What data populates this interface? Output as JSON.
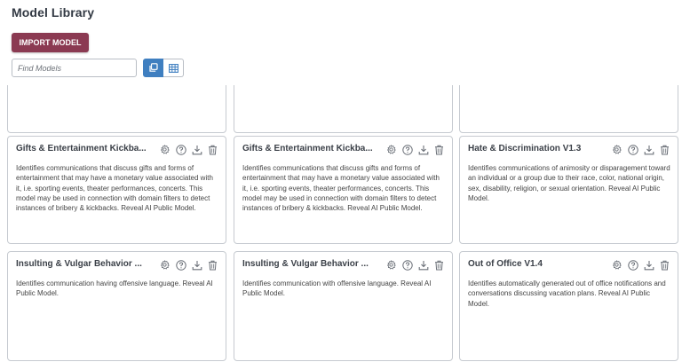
{
  "header": {
    "title": "Model Library"
  },
  "toolbar": {
    "import_label": "IMPORT MODEL",
    "search_placeholder": "Find Models",
    "colors": {
      "import": "#8b3a52",
      "active_view": "#3f7fc0"
    }
  },
  "cards": [
    {
      "title": "",
      "description": ""
    },
    {
      "title": "",
      "description": ""
    },
    {
      "title": "",
      "description": ""
    },
    {
      "title": "Gifts & Entertainment Kickba...",
      "description": "Identifies communications that discuss gifts and forms of entertainment that may have a monetary value associated with it, i.e. sporting events, theater performances, concerts. This model may be used in connection with domain filters to detect instances of bribery & kickbacks. Reveal AI Public Model."
    },
    {
      "title": "Gifts & Entertainment Kickba...",
      "description": "Identifies communications that discuss gifts and forms of entertainment that may have a monetary value associated with it, i.e. sporting events, theater performances, concerts. This model may be used in connection with domain filters to detect instances of bribery & kickbacks. Reveal AI Public Model."
    },
    {
      "title": "Hate & Discrimination V1.3",
      "description": "Identifies communications of animosity or disparagement toward an individual or a group due to their race, color, national origin, sex, disability, religion, or sexual orientation. Reveal AI Public Model."
    },
    {
      "title": "Insulting & Vulgar Behavior ...",
      "description": "Identifies communication having offensive language. Reveal AI Public Model."
    },
    {
      "title": "Insulting & Vulgar Behavior ...",
      "description": "Identifies communication with offensive language. Reveal AI Public Model."
    },
    {
      "title": "Out of Office V1.4",
      "description": "Identifies automatically generated out of office notifications and conversations discussing vacation plans. Reveal AI Public Model."
    }
  ],
  "card_icons": [
    "gear-icon",
    "help-icon",
    "download-icon",
    "trash-icon"
  ]
}
